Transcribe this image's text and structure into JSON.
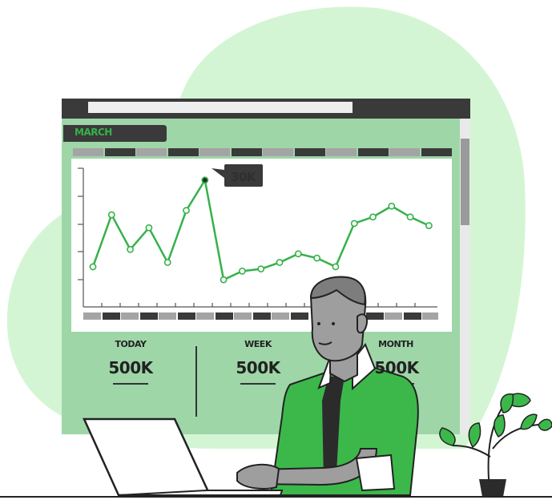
{
  "dashboard": {
    "month_tab": "MARCH",
    "tooltip": "30K",
    "stats": [
      {
        "label": "TODAY",
        "value": "500K"
      },
      {
        "label": "WEEK",
        "value": "500K"
      },
      {
        "label": "MONTH",
        "value": "500K"
      }
    ]
  },
  "chart_data": {
    "type": "line",
    "title": "",
    "xlabel": "",
    "ylabel": "",
    "series": [
      {
        "values": [
          10,
          22,
          14,
          19,
          11,
          23,
          30,
          7,
          9,
          9.5,
          11,
          13,
          12,
          10,
          20,
          21.5,
          24,
          21.5,
          19.5
        ]
      }
    ],
    "highlight_value": "30K",
    "ylim": [
      0,
      32
    ],
    "grid": false
  },
  "colors": {
    "accent": "#35b24a",
    "panel": "#9ed6a8",
    "blob": "#d3f5d3",
    "dark": "#3a3a3a"
  }
}
